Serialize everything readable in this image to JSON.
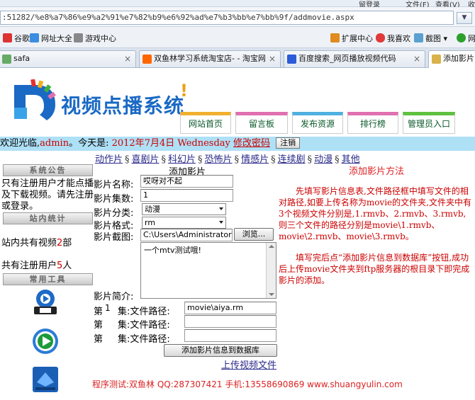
{
  "browser": {
    "address": ":51282/%e8%a7%86%e9%a2%91%e7%82%b9%e6%92%ad%e7%b3%bb%e7%bb%9f/addmovie.aspx",
    "top_items": [
      "留登录",
      "文件(F)",
      "查看(V)",
      "收"
    ],
    "favorites": [
      {
        "label": "谷歌",
        "icon": "google-icon"
      },
      {
        "label": "网址大全",
        "icon": "site-nav-icon"
      },
      {
        "label": "游戏中心",
        "icon": "gamepad-icon"
      },
      {
        "label": "扩展中心",
        "icon": "extension-icon"
      },
      {
        "label": "我喜欢",
        "icon": "heart-icon"
      },
      {
        "label": "截图",
        "icon": "scissors-icon"
      },
      {
        "label": "网",
        "icon": "globe-icon"
      }
    ],
    "tabs": [
      {
        "label": "safa"
      },
      {
        "label": "双鱼林学习系统淘宝店- - 淘宝网"
      },
      {
        "label": "百度搜索_网页播放视频代码"
      },
      {
        "label": "添加影片"
      }
    ]
  },
  "site": {
    "title": "视频点播系统",
    "excl": "!",
    "nav": [
      {
        "label": "网站首页",
        "color": "#f0b030"
      },
      {
        "label": "留言板",
        "color": "#e070b0"
      },
      {
        "label": "发布资源",
        "color": "#50b0e0"
      },
      {
        "label": "排行榜",
        "color": "#e070b0"
      },
      {
        "label": "管理员入口",
        "color": "#60c040"
      }
    ]
  },
  "welcome": {
    "prefix": "欢迎光临,",
    "user": "admin",
    "today_label": "。今天是:",
    "date": "2012年7月4日",
    "weekday": "Wednesday",
    "change_pwd": "修改密码",
    "logout": "注销"
  },
  "categories": [
    "动作片",
    "喜剧片",
    "科幻片",
    "恐怖片",
    "情感片",
    "连续剧",
    "动漫",
    "其他"
  ],
  "category_sep": "§",
  "sidebar": {
    "notice_head": "系统公告",
    "notice_text": "只有注册用户才能点播及下载视频。请先注册或登录。",
    "stats_head": "站内统计",
    "video_count_prefix": "站内共有视频",
    "video_count": "2",
    "video_count_suffix": "部",
    "user_count_prefix": "共有注册用户",
    "user_count": "5",
    "user_count_suffix": "人",
    "tools_head": "常用工具"
  },
  "form": {
    "heading": "添加影片",
    "name_label": "影片名称:",
    "name_value": "哎呀对不起",
    "episodes_label": "影片集数:",
    "episodes_value": "1",
    "category_label": "影片分类:",
    "category_value": "动漫",
    "format_label": "影片格式:",
    "format_value": "rm",
    "cover_label": "影片截图:",
    "cover_value": "C:\\Users\\Administrator\\De",
    "browse_label": "浏览...",
    "intro_label": "影片简介:",
    "intro_value": "一个mtv测试哦!",
    "ep_prefix": "第",
    "ep_suffix": "集:",
    "path_label": "文件路径:",
    "ep1_num": "1",
    "ep1_path": "movie\\aiya.rm",
    "submit": "添加影片信息到数据库",
    "upload_link": "上传视频文件"
  },
  "help": {
    "title": "添加影片方法",
    "para1": "先填写影片信息表,文件路径框中填写文件的相对路径,如要上传名称为movie的文件夹,文件夹中有3个视频文件分别是,1.rmvb、2.rmvb、3.rmvb,则三个文件的路径分别是movie\\1.rmvb、movie\\2.rmvb、movie\\3.rmvb。",
    "para2": "填写完后点“添加影片信息到数据库”按钮,成功后上传movie文件夹到ftp服务器的根目录下即完成影片的添加。"
  },
  "footer": "程序测试:双鱼林 QQ:287307421 手机:13558690869 www.shuangyulin.com"
}
